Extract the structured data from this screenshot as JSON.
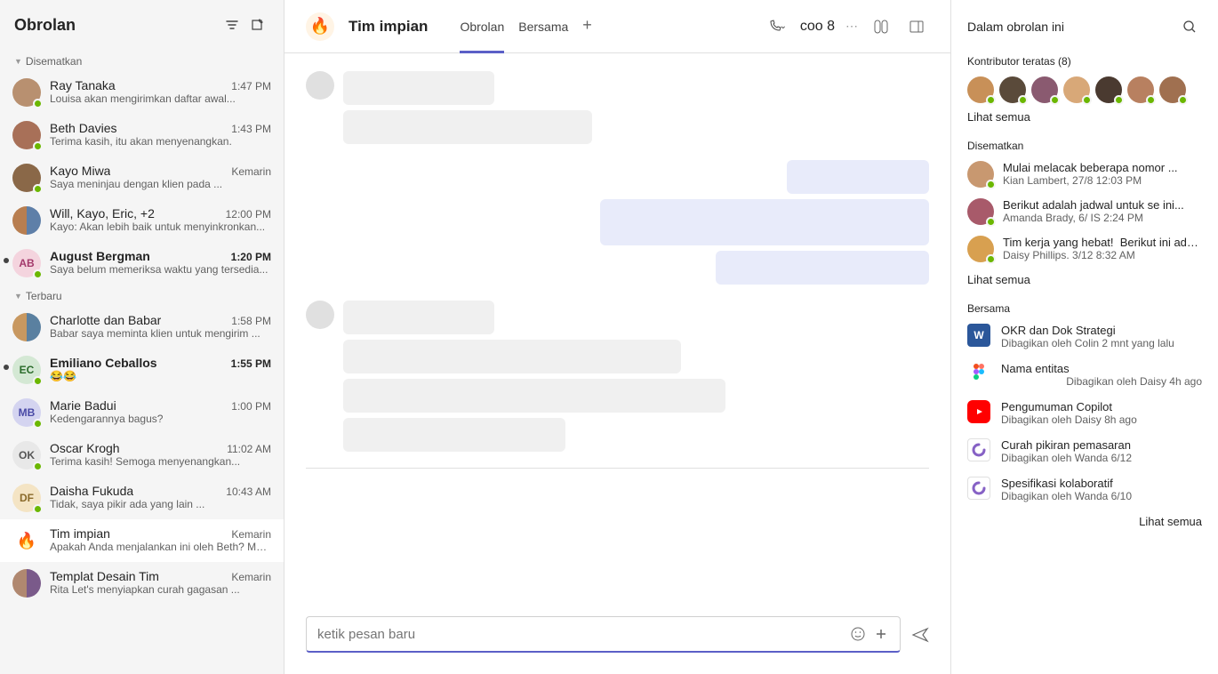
{
  "sidebar": {
    "title": "Obrolan",
    "sections": {
      "pinned": "Disematkan",
      "recent": "Terbaru"
    },
    "items": [
      {
        "name": "Ray Tanaka",
        "time": "1:47 PM",
        "preview": "Louisa akan mengirimkan daftar awal..."
      },
      {
        "name": "Beth  Davies",
        "time": "1:43 PM",
        "preview": "Terima kasih, itu akan menyenangkan."
      },
      {
        "name": "Kayo Miwa",
        "time": "Kemarin",
        "preview": "Saya meninjau dengan klien pada ..."
      },
      {
        "name": "Will, Kayo, Eric, +2",
        "time": "12:00 PM",
        "preview": "Kayo: Akan lebih baik untuk menyinkronkan..."
      },
      {
        "name": "August Bergman",
        "time": "1:20 PM",
        "preview": "Saya belum memeriksa waktu yang tersedia..."
      },
      {
        "name": "Charlotte dan    Babar",
        "time": "1:58 PM",
        "preview": "Babar saya meminta klien untuk mengirim ..."
      },
      {
        "name": "Emiliano Ceballos",
        "time": "1:55 PM",
        "preview": "😂😂"
      },
      {
        "name": "Marie Badui",
        "time": "1:00 PM",
        "preview": "Kedengarannya bagus?"
      },
      {
        "name": "Oscar Krogh",
        "time": "11:02 AM",
        "preview": "Terima kasih! Semoga menyenangkan..."
      },
      {
        "name": "Daisha Fukuda",
        "time": "10:43 AM",
        "preview": "Tidak, saya pikir ada yang lain ..."
      },
      {
        "name": "Tim impian",
        "time": "Kemarin",
        "preview": "Apakah Anda menjalankan ini oleh Beth? Membuat"
      },
      {
        "name": "Templat Desain Tim",
        "time": "Kemarin",
        "preview": "Rita Let's menyiapkan curah gagasan ..."
      }
    ]
  },
  "header": {
    "title": "Tim impian",
    "tabs": [
      "Obrolan",
      "Bersama"
    ],
    "participants": "coo 8"
  },
  "compose": {
    "placeholder": "ketik pesan baru"
  },
  "panel": {
    "title": "Dalam obrolan ini",
    "contributors_label": "Kontributor teratas (8)",
    "see_all": "Lihat semua",
    "pinned_label": "Disematkan",
    "pinned": [
      {
        "title": "Mulai melacak beberapa nomor ...",
        "meta": "Kian Lambert, 27/8 12:03 PM"
      },
      {
        "title": "Berikut adalah jadwal untuk se ini...",
        "meta": "Amanda Brady, 6/ IS 2:24 PM"
      },
      {
        "title": "Tim kerja yang hebat!",
        "title2": "Berikut ini adalah o...",
        "meta": "Daisy Phillips. 3/12 8:32 AM"
      }
    ],
    "shared_label": "Bersama",
    "shared": [
      {
        "title": "OKR dan Dok Strategi",
        "meta": "Dibagikan oleh Colin 2 mnt yang lalu",
        "type": "word"
      },
      {
        "title": "Nama entitas",
        "meta": "Dibagikan oleh Daisy 4h ago",
        "type": "figma"
      },
      {
        "title": "Pengumuman Copilot",
        "meta": "Dibagikan oleh Daisy 8h ago",
        "type": "yt"
      },
      {
        "title": "Curah pikiran pemasaran",
        "meta": "Dibagikan oleh Wanda 6/12",
        "type": "loop"
      },
      {
        "title": "Spesifikasi kolaboratif",
        "meta": "Dibagikan oleh Wanda 6/10",
        "type": "loop"
      }
    ]
  }
}
